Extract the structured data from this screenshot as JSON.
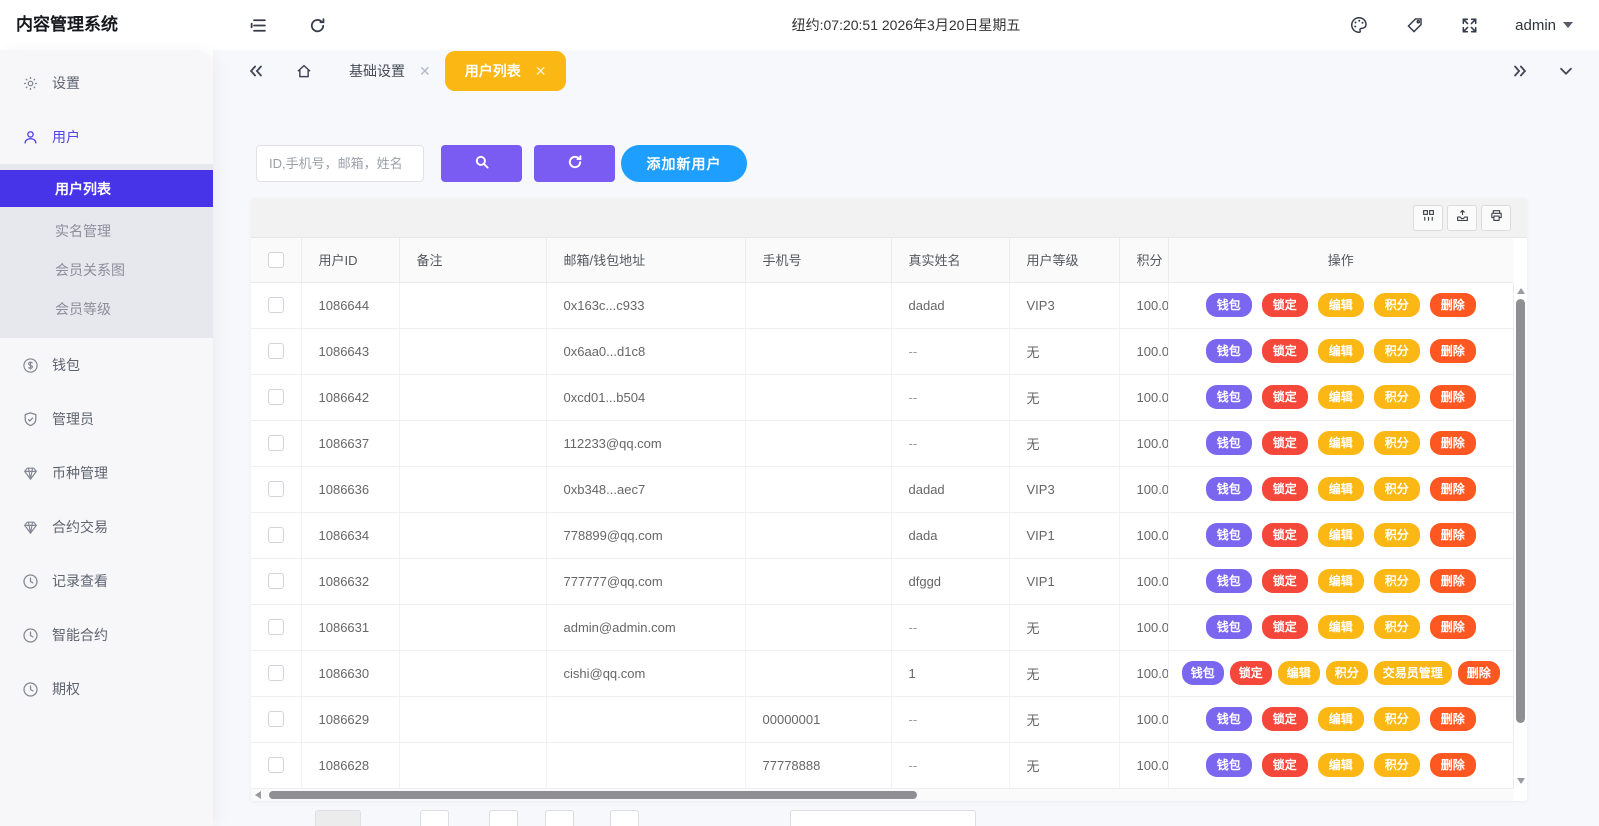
{
  "app": {
    "title": "内容管理系统"
  },
  "topbar": {
    "time": "纽约:07:20:51 2026年3月20日星期五",
    "user": "admin",
    "icons": [
      "menu-fold",
      "refresh",
      "palette",
      "tag",
      "fullscreen"
    ]
  },
  "tabs": {
    "items": [
      {
        "label": "基础设置",
        "active": false,
        "closable": true
      },
      {
        "label": "用户列表",
        "active": true,
        "closable": true
      }
    ]
  },
  "sidebar": {
    "items": [
      {
        "key": "settings",
        "label": "设置",
        "icon": "gear"
      },
      {
        "key": "users",
        "label": "用户",
        "icon": "user",
        "active": true,
        "children": [
          {
            "key": "user-list",
            "label": "用户列表",
            "active": true
          },
          {
            "key": "realname-manage",
            "label": "实名管理"
          },
          {
            "key": "member-relations",
            "label": "会员关系图"
          },
          {
            "key": "member-levels",
            "label": "会员等级"
          }
        ]
      },
      {
        "key": "wallet",
        "label": "钱包",
        "icon": "dollar"
      },
      {
        "key": "administrators",
        "label": "管理员",
        "icon": "shield"
      },
      {
        "key": "coin-manage",
        "label": "币种管理",
        "icon": "diamond"
      },
      {
        "key": "contract-trading",
        "label": "合约交易",
        "icon": "diamond"
      },
      {
        "key": "record-view",
        "label": "记录查看",
        "icon": "clock"
      },
      {
        "key": "smart-contract",
        "label": "智能合约",
        "icon": "clock"
      },
      {
        "key": "options",
        "label": "期权",
        "icon": "clock"
      }
    ]
  },
  "toolbar": {
    "search_placeholder": "ID,手机号，邮箱，姓名",
    "add_user_label": "添加新用户"
  },
  "action_defs": {
    "wallet": {
      "label": "钱包",
      "color": "#7b66f0"
    },
    "lock": {
      "label": "锁定",
      "color": "#f5483b"
    },
    "edit": {
      "label": "编辑",
      "color": "#fbb714"
    },
    "points": {
      "label": "积分",
      "color": "#fbb714"
    },
    "trader": {
      "label": "交易员管理",
      "color": "#fbb714"
    },
    "delete": {
      "label": "删除",
      "color": "#ff5722"
    }
  },
  "table": {
    "columns": [
      "用户ID",
      "备注",
      "邮箱/钱包地址",
      "手机号",
      "真实姓名",
      "用户等级",
      "积分",
      "操作"
    ],
    "rows": [
      {
        "id": "1086644",
        "remark": "",
        "email": "0x163c...c933",
        "phone": "",
        "name": "dadad",
        "level": "VIP3",
        "points": "100.0",
        "actions": [
          "wallet",
          "lock",
          "edit",
          "points",
          "delete"
        ]
      },
      {
        "id": "1086643",
        "remark": "",
        "email": "0x6aa0...d1c8",
        "phone": "",
        "name": "--",
        "level": "无",
        "points": "100.0",
        "actions": [
          "wallet",
          "lock",
          "edit",
          "points",
          "delete"
        ]
      },
      {
        "id": "1086642",
        "remark": "",
        "email": "0xcd01...b504",
        "phone": "",
        "name": "--",
        "level": "无",
        "points": "100.0",
        "actions": [
          "wallet",
          "lock",
          "edit",
          "points",
          "delete"
        ]
      },
      {
        "id": "1086637",
        "remark": "",
        "email": "112233@qq.com",
        "phone": "",
        "name": "--",
        "level": "无",
        "points": "100.0",
        "actions": [
          "wallet",
          "lock",
          "edit",
          "points",
          "delete"
        ]
      },
      {
        "id": "1086636",
        "remark": "",
        "email": "0xb348...aec7",
        "phone": "",
        "name": "dadad",
        "level": "VIP3",
        "points": "100.0",
        "actions": [
          "wallet",
          "lock",
          "edit",
          "points",
          "delete"
        ]
      },
      {
        "id": "1086634",
        "remark": "",
        "email": "778899@qq.com",
        "phone": "",
        "name": "dada",
        "level": "VIP1",
        "points": "100.0",
        "actions": [
          "wallet",
          "lock",
          "edit",
          "points",
          "delete"
        ]
      },
      {
        "id": "1086632",
        "remark": "",
        "email": "777777@qq.com",
        "phone": "",
        "name": "dfggd",
        "level": "VIP1",
        "points": "100.0",
        "actions": [
          "wallet",
          "lock",
          "edit",
          "points",
          "delete"
        ]
      },
      {
        "id": "1086631",
        "remark": "",
        "email": "admin@admin.com",
        "phone": "",
        "name": "--",
        "level": "无",
        "points": "100.0",
        "actions": [
          "wallet",
          "lock",
          "edit",
          "points",
          "delete"
        ]
      },
      {
        "id": "1086630",
        "remark": "",
        "email": "cishi@qq.com",
        "phone": "",
        "name": "1",
        "level": "无",
        "points": "100.0",
        "actions": [
          "wallet",
          "lock",
          "edit",
          "points",
          "trader",
          "delete"
        ]
      },
      {
        "id": "1086629",
        "remark": "",
        "email": "",
        "phone": "00000001",
        "name": "--",
        "level": "无",
        "points": "100.0",
        "actions": [
          "wallet",
          "lock",
          "edit",
          "points",
          "delete"
        ]
      },
      {
        "id": "1086628",
        "remark": "",
        "email": "",
        "phone": "77778888",
        "name": "--",
        "level": "无",
        "points": "100.0",
        "actions": [
          "wallet",
          "lock",
          "edit",
          "points",
          "delete"
        ]
      }
    ]
  }
}
